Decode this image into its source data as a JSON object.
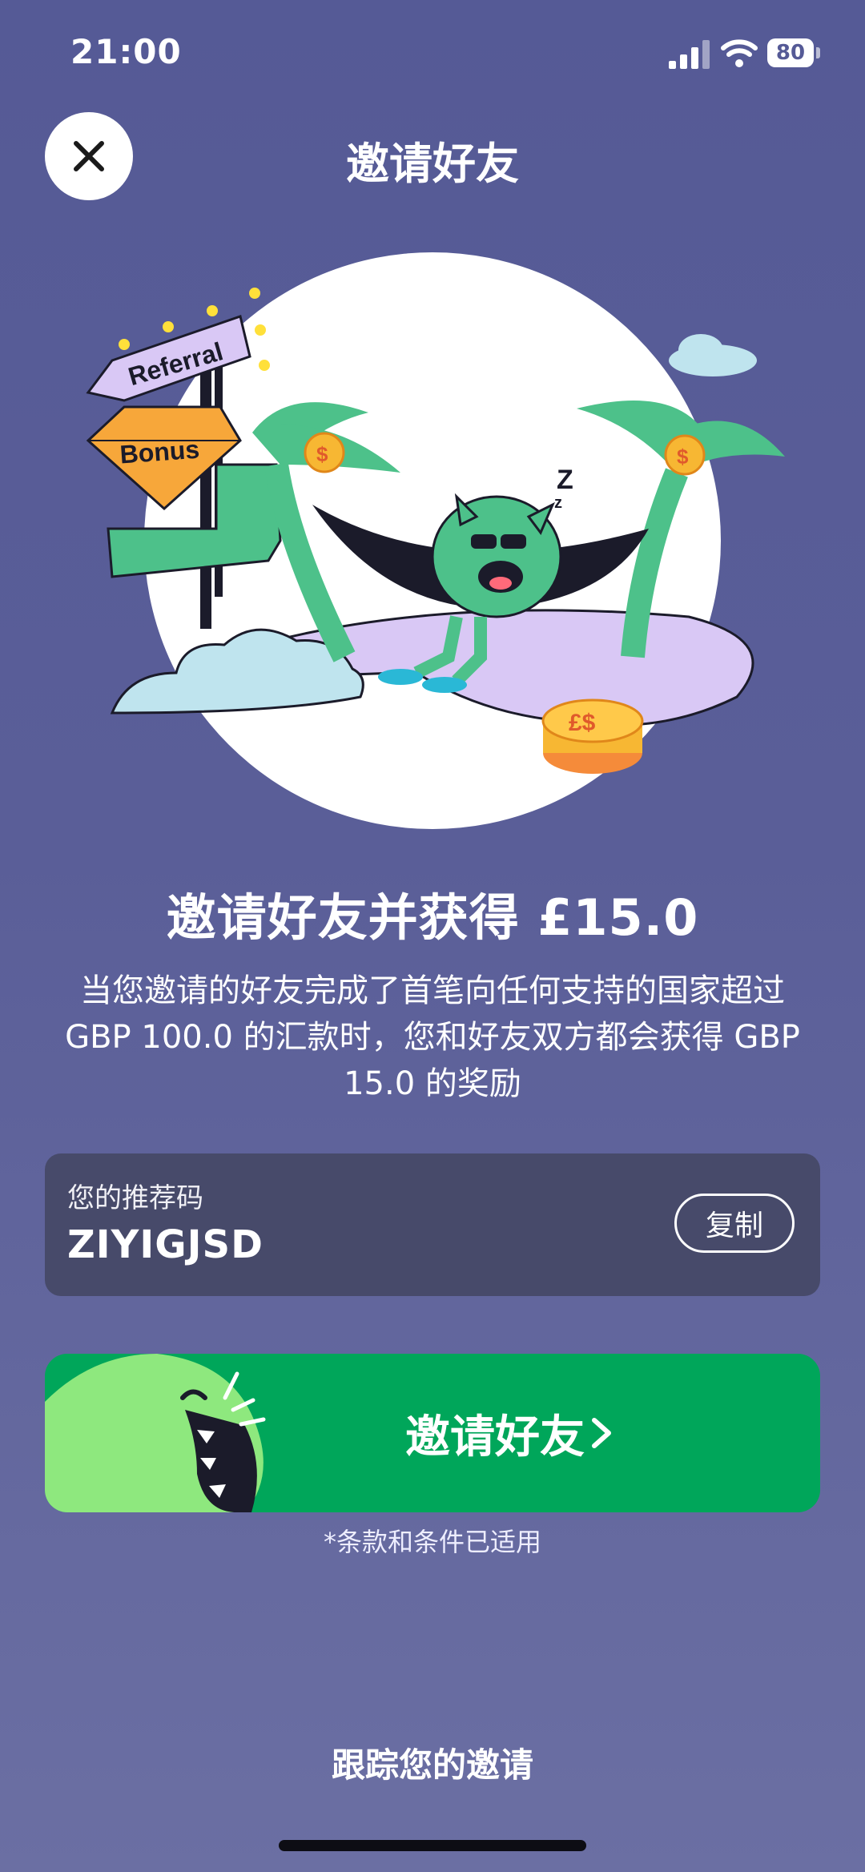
{
  "status_bar": {
    "time": "21:00",
    "battery": "80"
  },
  "nav": {
    "title": "邀请好友"
  },
  "hero": {
    "sign_text": "Referral",
    "gem_text": "Bonus",
    "sleep_text": "Z"
  },
  "headline": "邀请好友并获得 £15.0",
  "description": "当您邀请的好友完成了首笔向任何支持的国家超过 GBP 100.0 的汇款时，您和好友双方都会获得 GBP 15.0 的奖励",
  "referral": {
    "label": "您的推荐码",
    "code": "ZIYIGJSD",
    "copy_label": "复制"
  },
  "invite_button": {
    "label": "邀请好友"
  },
  "terms": "*条款和条件已适用",
  "track_link": "跟踪您的邀请",
  "colors": {
    "background": "#555a96",
    "accent_green": "#00a65a",
    "card": "#474a6a"
  }
}
